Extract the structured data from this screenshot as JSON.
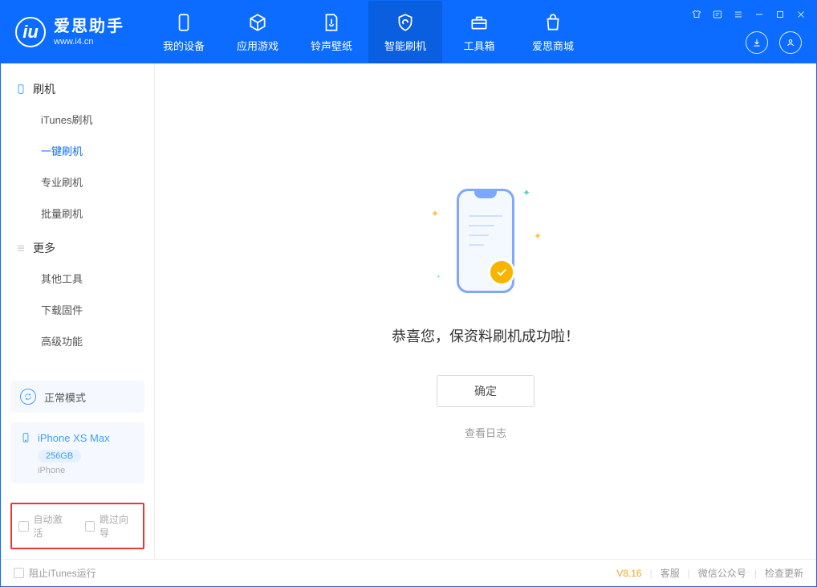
{
  "brand": {
    "title": "爱思助手",
    "subtitle": "www.i4.cn"
  },
  "tabs": [
    "我的设备",
    "应用游戏",
    "铃声壁纸",
    "智能刷机",
    "工具箱",
    "爱思商城"
  ],
  "active_tab_index": 3,
  "sidebar": {
    "group1": {
      "title": "刷机",
      "items": [
        "iTunes刷机",
        "一键刷机",
        "专业刷机",
        "批量刷机"
      ],
      "active_index": 1
    },
    "group2": {
      "title": "更多",
      "items": [
        "其他工具",
        "下载固件",
        "高级功能"
      ]
    }
  },
  "mode": {
    "label": "正常模式"
  },
  "device": {
    "name": "iPhone XS Max",
    "capacity": "256GB",
    "type": "iPhone"
  },
  "checkboxes": {
    "auto_activate": "自动激活",
    "skip_guide": "跳过向导"
  },
  "main": {
    "headline": "恭喜您，保资料刷机成功啦！",
    "confirm_label": "确定",
    "view_log": "查看日志"
  },
  "footer": {
    "block_itunes": "阻止iTunes运行",
    "version": "V8.16",
    "links": [
      "客服",
      "微信公众号",
      "检查更新"
    ]
  }
}
